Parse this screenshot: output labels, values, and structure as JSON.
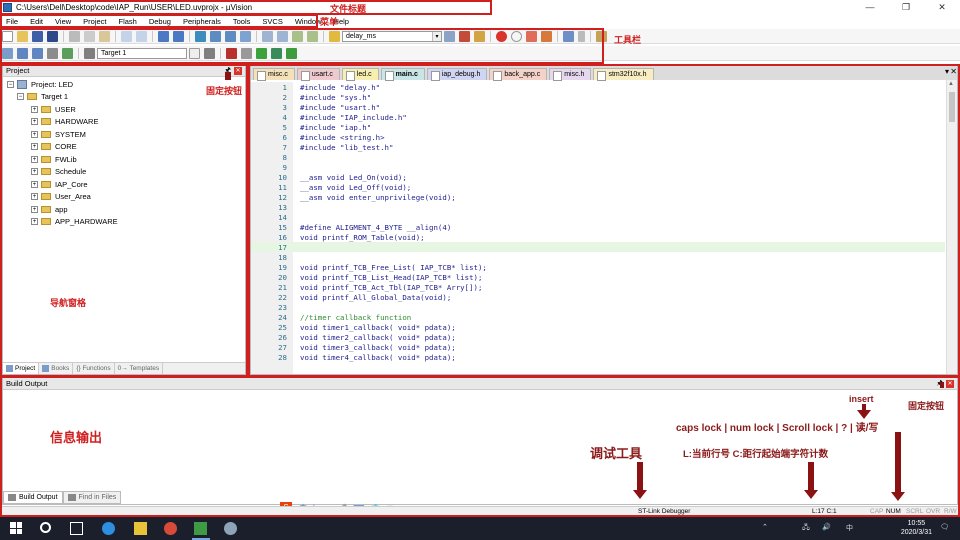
{
  "window": {
    "title": "C:\\Users\\Dell\\Desktop\\code\\IAP_Run\\USER\\LED.uvprojx - µVision",
    "controls": [
      "—",
      "❐",
      "✕"
    ]
  },
  "menu": [
    "File",
    "Edit",
    "View",
    "Project",
    "Flash",
    "Debug",
    "Peripherals",
    "Tools",
    "SVCS",
    "Window",
    "Help"
  ],
  "toolbar": {
    "function_combo": "delay_ms",
    "target_combo": "Target 1"
  },
  "project_pane": {
    "title": "Project",
    "root": "Project: LED",
    "target": "Target 1",
    "groups": [
      "USER",
      "HARDWARE",
      "SYSTEM",
      "CORE",
      "FWLib",
      "Schedule",
      "IAP_Core",
      "User_Area",
      "app",
      "APP_HARDWARE"
    ],
    "tabs": [
      "Project",
      "Books",
      "{} Functions",
      "0→ Templates"
    ]
  },
  "editor": {
    "tabs": [
      "misc.c",
      "usart.c",
      "led.c",
      "main.c",
      "iap_debug.h",
      "back_app.c",
      "misc.h",
      "stm32f10x.h"
    ],
    "active_tab": "main.c",
    "current_line": 17,
    "lines": [
      {
        "n": "1",
        "text": "#include \"delay.h\""
      },
      {
        "n": "2",
        "text": "#include \"sys.h\""
      },
      {
        "n": "3",
        "text": "#include \"usart.h\""
      },
      {
        "n": "4",
        "text": "#include \"IAP_include.h\""
      },
      {
        "n": "5",
        "text": "#include \"iap.h\""
      },
      {
        "n": "6",
        "text": "#include <string.h>"
      },
      {
        "n": "7",
        "text": "#include \"lib_test.h\""
      },
      {
        "n": "8",
        "text": ""
      },
      {
        "n": "9",
        "text": ""
      },
      {
        "n": "10",
        "text": "__asm void Led_On(void);"
      },
      {
        "n": "11",
        "text": "__asm void Led_Off(void);"
      },
      {
        "n": "12",
        "text": "__asm void enter_unprivilege(void);"
      },
      {
        "n": "13",
        "text": ""
      },
      {
        "n": "14",
        "text": ""
      },
      {
        "n": "15",
        "text": "#define ALIGMENT_4_BYTE __align(4)"
      },
      {
        "n": "16",
        "text": "void printf_ROM_Table(void);"
      },
      {
        "n": "17",
        "text": ""
      },
      {
        "n": "18",
        "text": ""
      },
      {
        "n": "19",
        "text": "void printf_TCB_Free_List( IAP_TCB* list);"
      },
      {
        "n": "20",
        "text": "void printf_TCB_List_Head(IAP_TCB* list);"
      },
      {
        "n": "21",
        "text": "void printf_TCB_Act_Tbl(IAP_TCB* Arry[]);"
      },
      {
        "n": "22",
        "text": "void printf_All_Global_Data(void);"
      },
      {
        "n": "23",
        "text": ""
      },
      {
        "n": "24",
        "text": "//timer callback function"
      },
      {
        "n": "25",
        "text": "void timer1_callback( void* pdata);"
      },
      {
        "n": "26",
        "text": "void timer2_callback( void* pdata);"
      },
      {
        "n": "27",
        "text": "void timer3_callback( void* pdata);"
      },
      {
        "n": "28",
        "text": "void timer4_callback( void* pdata);"
      }
    ]
  },
  "build_output": {
    "title": "Build Output",
    "tabs": [
      "Build Output",
      "Find in Files"
    ]
  },
  "statusbar": {
    "debugger": "ST-Link Debugger",
    "position": "L:17 C:1",
    "cap": "CAP",
    "num": "NUM",
    "scrl": "SCRL",
    "ovr": "OVR",
    "rw": "R/W"
  },
  "ime": [
    "中",
    "ʼ,",
    "☺",
    "🎤",
    "⌨",
    "👕",
    "⊞"
  ],
  "taskbar": {
    "time": "10:55",
    "date": "2020/3/31",
    "tray_lang": "中"
  },
  "annotations": {
    "title_bar": "文件标题",
    "menu_bar": "菜单",
    "toolbar": "工具栏",
    "pin_button_1": "固定按钮",
    "nav_pane": "导航窗格",
    "info_output": "信息输出",
    "pin_button_2": "固定按钮",
    "insert": "insert",
    "locks": "caps lock | num lock | Scroll lock | ? | 读/写",
    "debug_tool": "调试工具",
    "line_col": "L:当前行号 C:距行起始端字符计数"
  },
  "colors": {
    "annotation_red": "#d01f1f",
    "arrow_dark_red": "#8b1212",
    "current_line": "#e7f6e3",
    "taskbar": "#1a1f2b"
  }
}
